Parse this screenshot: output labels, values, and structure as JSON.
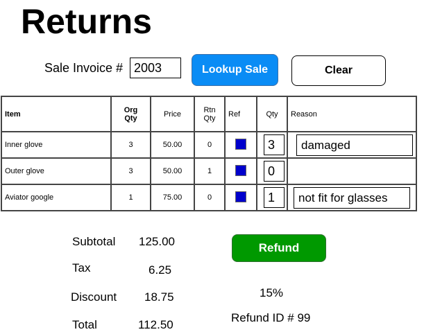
{
  "title": "Returns",
  "invoice": {
    "label": "Sale Invoice #",
    "value": "2003"
  },
  "buttons": {
    "lookup": "Lookup Sale",
    "clear": "Clear",
    "refund": "Refund"
  },
  "colors": {
    "lookup": "#0a8cf5",
    "refund": "#009900",
    "ref_box": "#0000cc"
  },
  "table": {
    "headers": {
      "item": "Item",
      "org_qty_1": "Org",
      "org_qty_2": "Qty",
      "price": "Price",
      "rtn_qty_1": "Rtn",
      "rtn_qty_2": "Qty",
      "ref": "Ref",
      "qty": "Qty",
      "reason": "Reason"
    },
    "rows": [
      {
        "item": "Inner glove",
        "org_qty": "3",
        "price": "50.00",
        "rtn_qty": "0",
        "qty": "3",
        "reason": "damaged"
      },
      {
        "item": "Outer glove",
        "org_qty": "3",
        "price": "50.00",
        "rtn_qty": "1",
        "qty": "0",
        "reason": ""
      },
      {
        "item": "Aviator google",
        "org_qty": "1",
        "price": "75.00",
        "rtn_qty": "0",
        "qty": "1",
        "reason": "not fit for glasses"
      }
    ]
  },
  "summary": {
    "subtotal_label": "Subtotal",
    "subtotal": "125.00",
    "tax_label": "Tax",
    "tax": "6.25",
    "discount_label": "Discount",
    "discount": "18.75",
    "total_label": "Total",
    "total": "112.50"
  },
  "discount_pct": "15%",
  "refund_id": "Refund ID # 99"
}
